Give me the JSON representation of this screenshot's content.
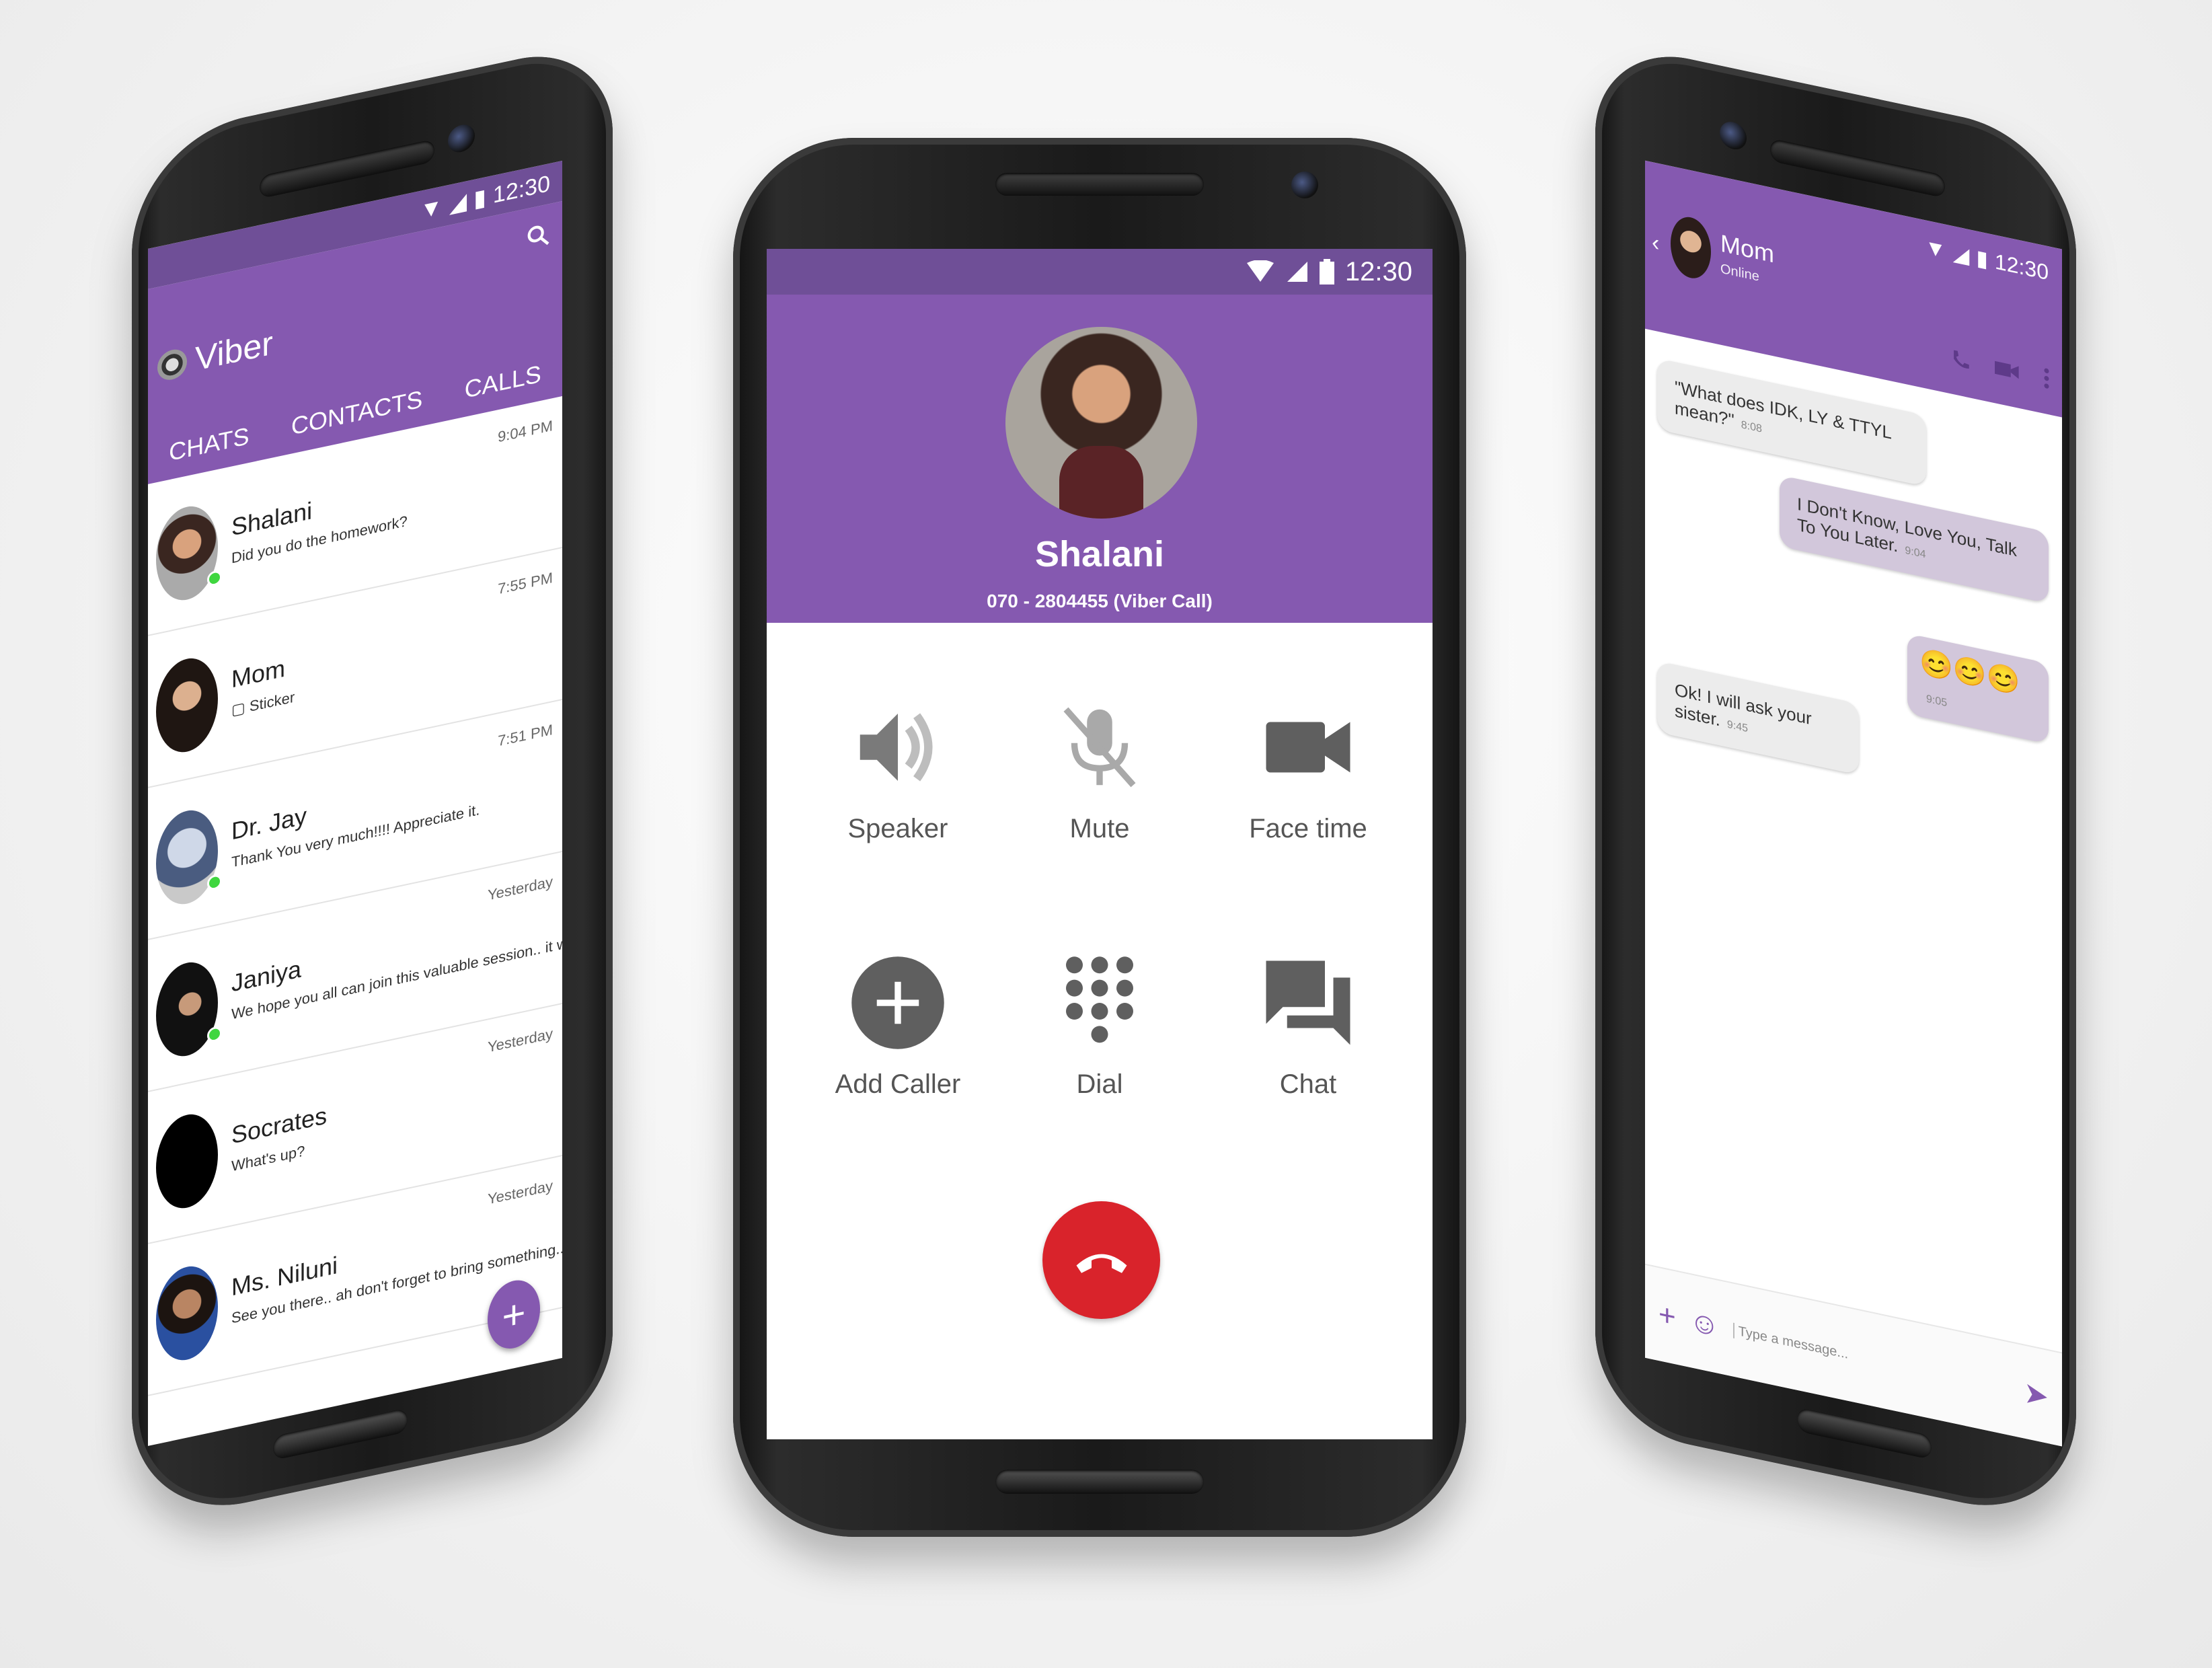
{
  "status_bar": {
    "time": "12:30"
  },
  "left_phone": {
    "app_title": "Viber",
    "tabs": [
      "CHATS",
      "CONTACTS",
      "CALLS"
    ],
    "chats": [
      {
        "name": "Shalani",
        "message": "Did you do the homework?",
        "time": "9:04 PM",
        "online": true
      },
      {
        "name": "Mom",
        "message": "Sticker",
        "time": "7:55 PM",
        "online": false
      },
      {
        "name": "Dr. Jay",
        "message": "Thank You very much!!!! Appreciate it.",
        "time": "7:51 PM",
        "online": true
      },
      {
        "name": "Janiya",
        "message": "We hope you all can join this valuable session.. it wi...",
        "time": "Yesterday",
        "online": true
      },
      {
        "name": "Socrates",
        "message": "What's up?",
        "time": "Yesterday",
        "online": false
      },
      {
        "name": "Ms. Niluni",
        "message": "See you there.. ah don't forget to bring something...",
        "time": "Yesterday",
        "online": false
      }
    ],
    "fab_label": "+"
  },
  "center_phone": {
    "caller_name": "Shalani",
    "caller_number": "070 - 2804455 (Viber Call)",
    "actions": [
      {
        "label": "Speaker",
        "icon": "speaker-icon"
      },
      {
        "label": "Mute",
        "icon": "mute-mic-icon"
      },
      {
        "label": "Face time",
        "icon": "video-camera-icon"
      },
      {
        "label": "Add Caller",
        "icon": "add-circle-icon"
      },
      {
        "label": "Dial",
        "icon": "dialpad-icon"
      },
      {
        "label": "Chat",
        "icon": "chat-bubbles-icon"
      }
    ],
    "end_call_icon": "end-call-icon",
    "accent": "#8559b0",
    "status_color": "#6f4f97",
    "end_call_color": "#d9232b"
  },
  "right_phone": {
    "contact_name": "Mom",
    "contact_status": "Online",
    "messages": [
      {
        "direction": "in",
        "text": "\"What does IDK, LY & TTYL mean?\"",
        "time": "8:08"
      },
      {
        "direction": "out",
        "text": "I Don't Know, Love You, Talk To You Later.",
        "time": "9:04"
      },
      {
        "direction": "out",
        "text": "😊😊😊",
        "time": "9:05"
      },
      {
        "direction": "in",
        "text": "Ok! I will ask your sister.",
        "time": "9:45"
      }
    ],
    "input_placeholder": "Type a message..."
  }
}
